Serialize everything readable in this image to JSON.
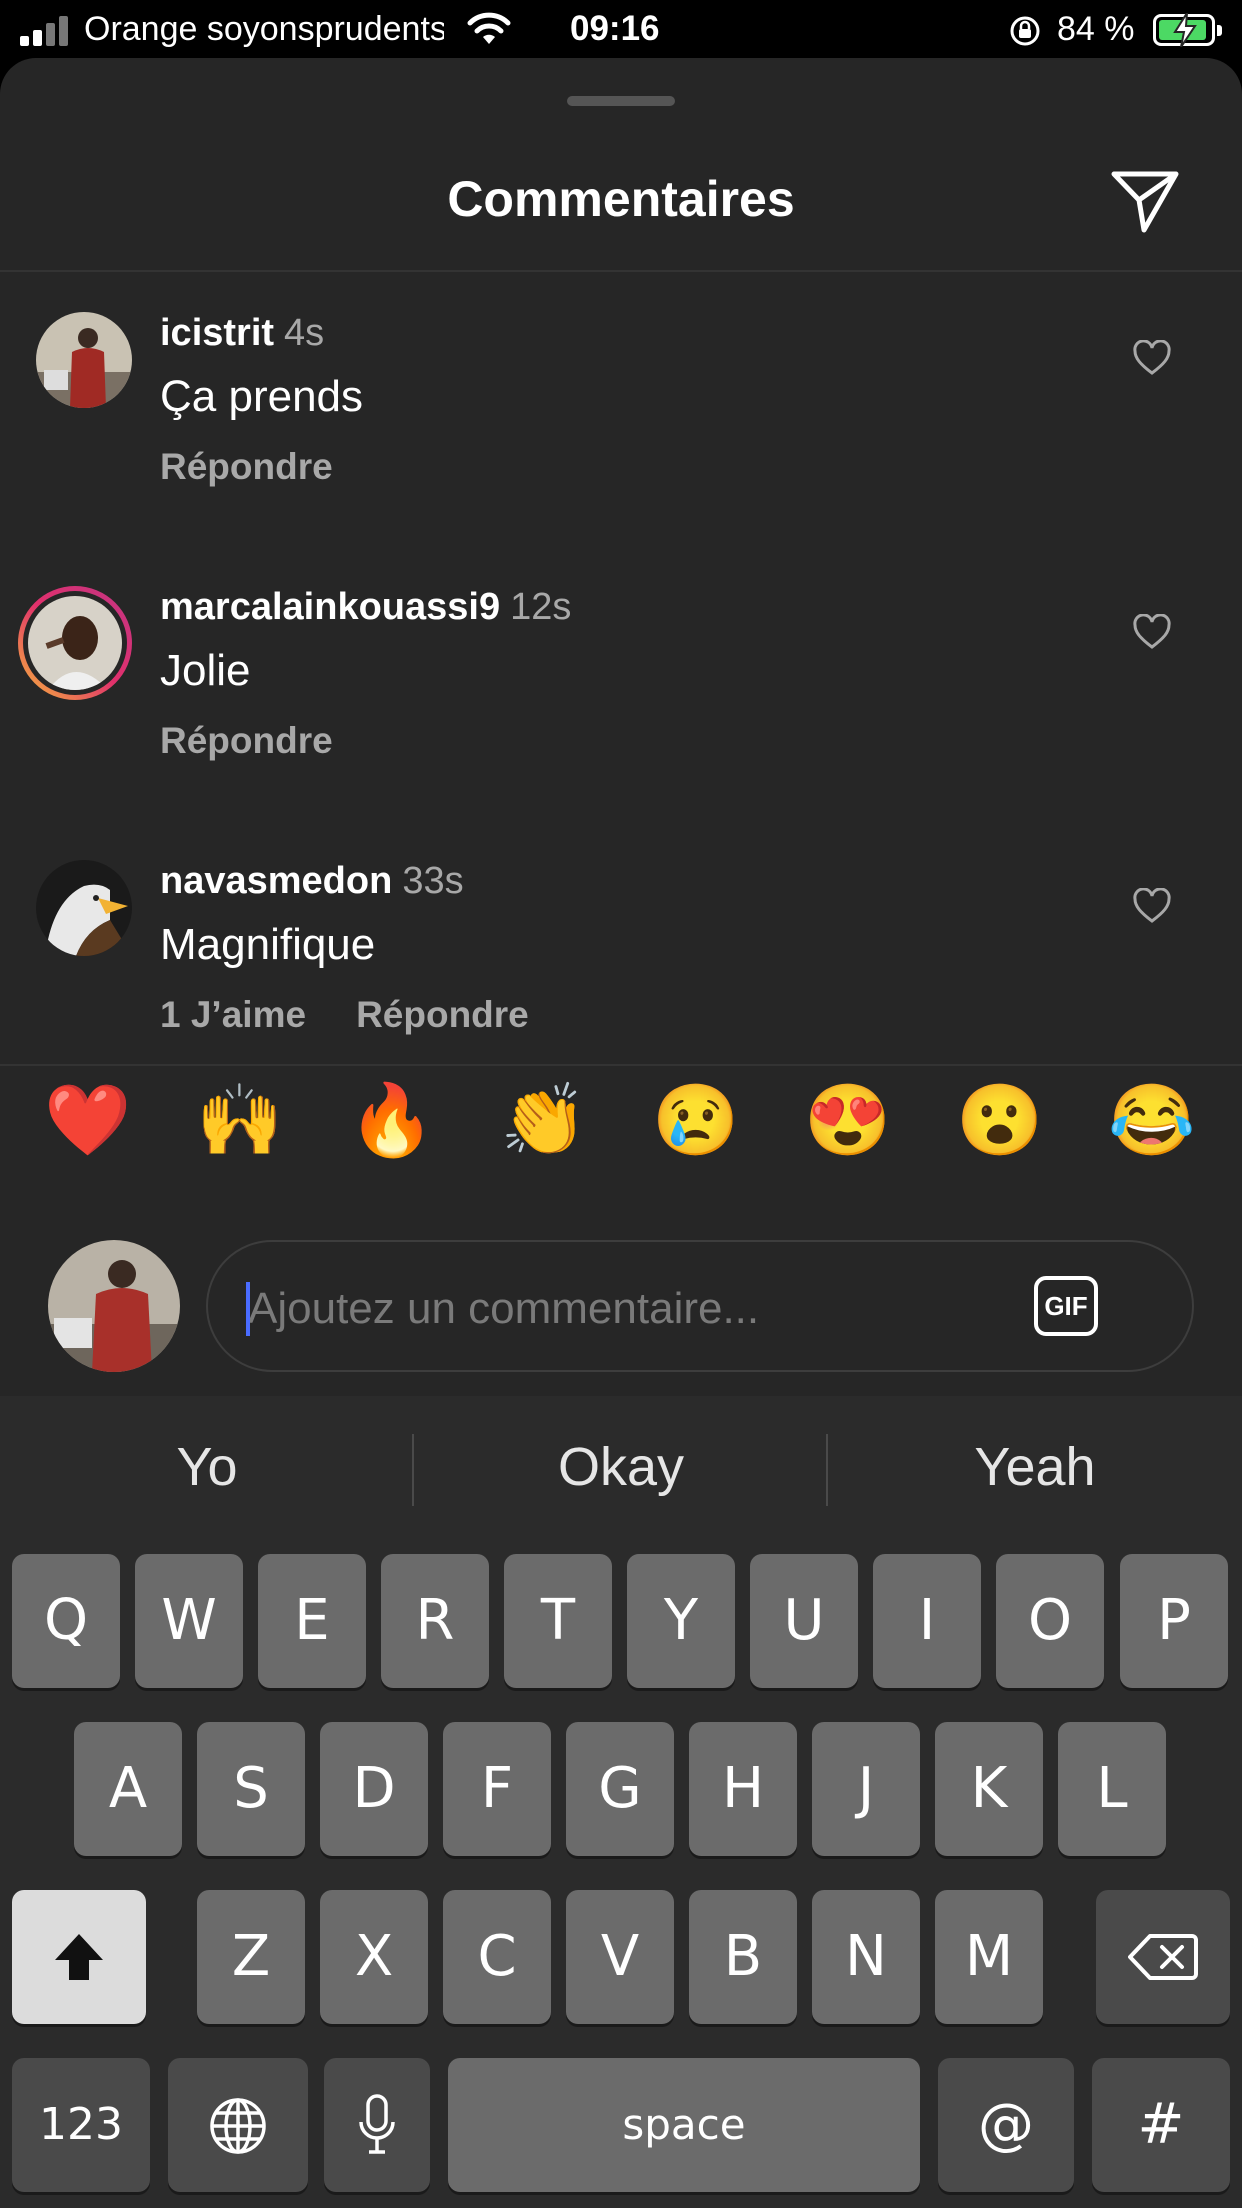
{
  "status_bar": {
    "carrier": "Orange soyonsprudents",
    "time": "09:16",
    "battery_percent": "84 %"
  },
  "sheet": {
    "title": "Commentaires"
  },
  "comments": [
    {
      "username": "icistrit",
      "age": "4s",
      "text": "Ça prends",
      "likes": "",
      "reply": "Répondre"
    },
    {
      "username": "marcalainkouassi9",
      "age": "12s",
      "text": "Jolie",
      "likes": "",
      "reply": "Répondre"
    },
    {
      "username": "navasmedon",
      "age": "33s",
      "text": "Magnifique",
      "likes": "1 J’aime",
      "reply": "Répondre"
    }
  ],
  "reactions": [
    "❤️",
    "🙌",
    "🔥",
    "👏",
    "😢",
    "😍",
    "😮",
    "😂"
  ],
  "input": {
    "placeholder": "Ajoutez un commentaire...",
    "gif_label": "GIF"
  },
  "keyboard": {
    "suggestions": [
      "Yo",
      "Okay",
      "Yeah"
    ],
    "row1": [
      "Q",
      "W",
      "E",
      "R",
      "T",
      "Y",
      "U",
      "I",
      "O",
      "P"
    ],
    "row2": [
      "A",
      "S",
      "D",
      "F",
      "G",
      "H",
      "J",
      "K",
      "L"
    ],
    "row3": [
      "Z",
      "X",
      "C",
      "V",
      "B",
      "N",
      "M"
    ],
    "numbers_label": "123",
    "space_label": "space",
    "at_label": "@",
    "hash_label": "#"
  },
  "colors": {
    "sheet_bg": "#262626",
    "keyboard_bg": "#2b2b2b",
    "key_bg": "#6b6b6b",
    "caret": "#4a6cff",
    "battery_fill": "#4cd964"
  },
  "icons": [
    "signal-icon",
    "wifi-icon",
    "rotation-lock-icon",
    "battery-icon",
    "share-icon",
    "heart-icon",
    "shift-icon",
    "delete-icon",
    "globe-icon",
    "microphone-icon"
  ]
}
